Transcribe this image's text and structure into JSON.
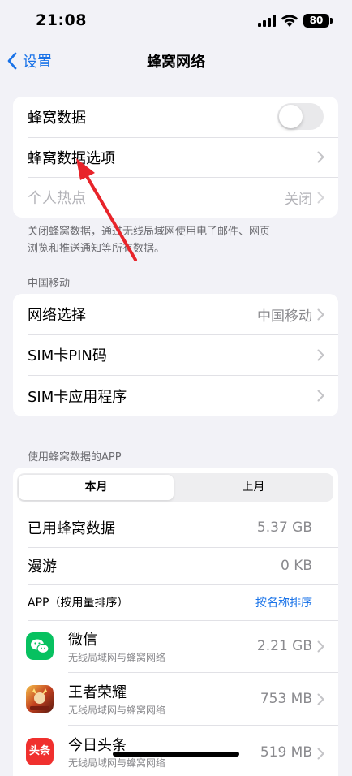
{
  "status": {
    "time": "21:08",
    "battery": "80"
  },
  "nav": {
    "back_label": "设置",
    "title": "蜂窝网络"
  },
  "group1": {
    "cellular_data": {
      "label": "蜂窝数据",
      "enabled": false
    },
    "cellular_options": {
      "label": "蜂窝数据选项"
    },
    "hotspot": {
      "label": "个人热点",
      "value": "关闭"
    }
  },
  "footnote": {
    "line1": "关闭蜂窝数据，通过无线局域网使用电子邮件、网页",
    "line2": "浏览和推送通知等所有数据。"
  },
  "carrier_section": {
    "header": "中国移动",
    "network_select": {
      "label": "网络选择",
      "value": "中国移动"
    },
    "sim_pin": {
      "label": "SIM卡PIN码"
    },
    "sim_apps": {
      "label": "SIM卡应用程序"
    }
  },
  "usage_section": {
    "header": "使用蜂窝数据的APP",
    "tabs": {
      "current": "本月",
      "previous": "上月"
    },
    "used": {
      "label": "已用蜂窝数据",
      "value": "5.37 GB"
    },
    "roaming": {
      "label": "漫游",
      "value": "0 KB"
    },
    "apps_header": {
      "label": "APP（按用量排序）",
      "sort_link": "按名称排序"
    },
    "apps": [
      {
        "name": "微信",
        "subtitle": "无线局域网与蜂窝网络",
        "usage": "2.21 GB"
      },
      {
        "name": "王者荣耀",
        "subtitle": "无线局域网与蜂窝网络",
        "usage": "753 MB"
      },
      {
        "name": "今日头条",
        "subtitle": "无线局域网与蜂窝网络",
        "usage": "519 MB",
        "icon_text": "头条"
      }
    ]
  },
  "colors": {
    "accent": "#1a73e8",
    "annotation_arrow": "#e8242a",
    "wechat_green": "#07c160",
    "toutiao_red": "#f0302e"
  }
}
